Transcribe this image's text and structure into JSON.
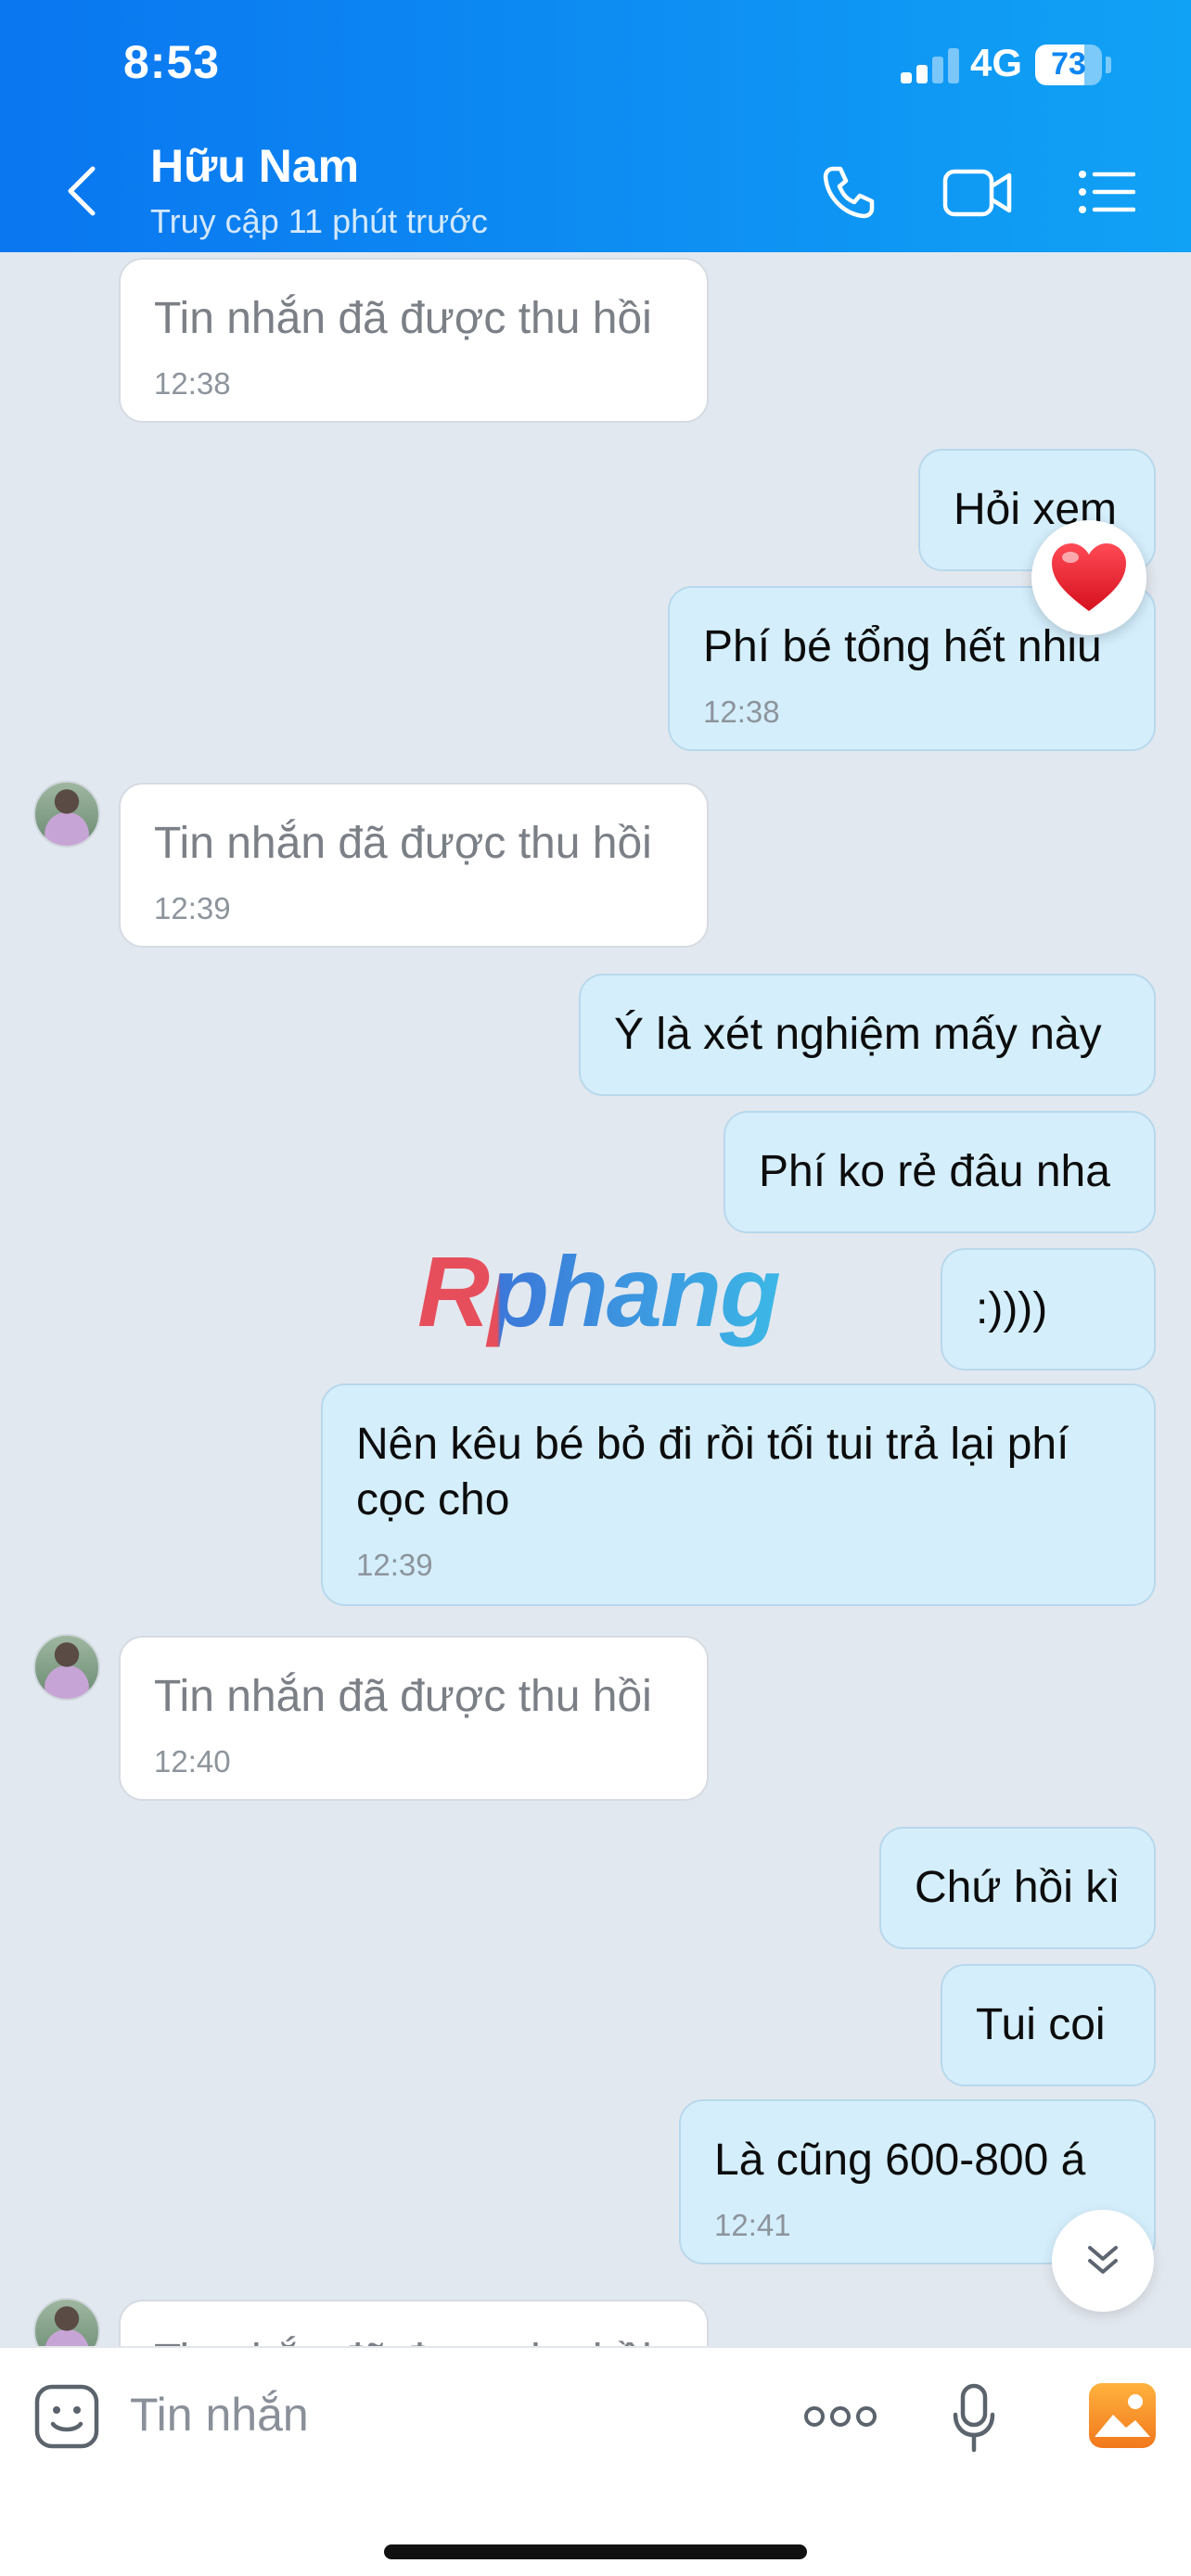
{
  "status_bar": {
    "time": "8:53",
    "network": "4G",
    "battery": "73",
    "battery_level": 0.73
  },
  "header": {
    "name": "Hữu Nam",
    "status": "Truy cập 11 phút trước"
  },
  "messages": [
    {
      "text": "Tin nhắn đã được thu hồi",
      "time": "12:38"
    },
    {
      "text": "Hỏi xem"
    },
    {
      "text": "Phí bé tổng hết nhiu",
      "time": "12:38"
    },
    {
      "text": "Tin nhắn đã được thu hồi",
      "time": "12:39"
    },
    {
      "text": "Ý là xét nghiệm mấy này"
    },
    {
      "text": "Phí ko rẻ đâu nha"
    },
    {
      "text": ":))))"
    },
    {
      "text": "Nên kêu bé bỏ đi rồi tối tui trả lại phí cọc cho",
      "time": "12:39"
    },
    {
      "text": "Tin nhắn đã được thu hồi",
      "time": "12:40"
    },
    {
      "text": "Chứ hồi kì"
    },
    {
      "text": "Tui coi"
    },
    {
      "text": "Là cũng 600-800 á",
      "time": "12:41"
    },
    {
      "text": "Tin nhắn đã được thu hồi"
    }
  ],
  "reaction": "heart-icon",
  "watermark": "Rphang",
  "input": {
    "placeholder": "Tin nhắn"
  },
  "colors": {
    "header_start": "#0a76f0",
    "header_end": "#10a2f5",
    "outgoing_bubble": "#d4eefc",
    "incoming_bubble": "#ffffff",
    "background": "#e2e8ef"
  }
}
